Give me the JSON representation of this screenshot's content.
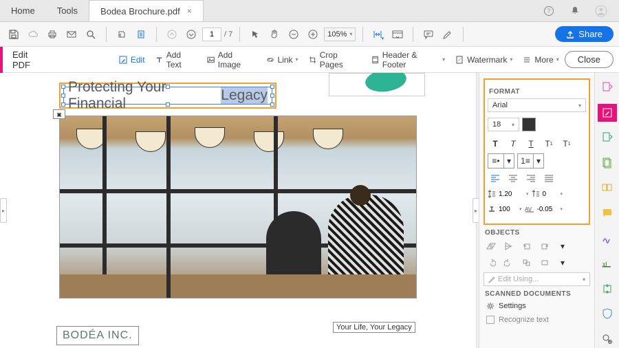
{
  "tabs": {
    "home": "Home",
    "tools": "Tools",
    "doc": "Bodea Brochure.pdf"
  },
  "toolbar": {
    "page_current": "1",
    "page_total": "/ 7",
    "zoom": "105%",
    "share": "Share"
  },
  "subtool": {
    "title": "Edit PDF",
    "edit": "Edit",
    "add_text": "Add Text",
    "add_image": "Add Image",
    "link": "Link",
    "crop": "Crop Pages",
    "header": "Header & Footer",
    "watermark": "Watermark",
    "more": "More",
    "close": "Close"
  },
  "doc": {
    "heading_pre": "Protecting Your Financial ",
    "heading_sel": "Legacy",
    "tagline": "Your Life, Your Legacy",
    "logo": "BODÉA INC."
  },
  "format": {
    "title": "FORMAT",
    "font": "Arial",
    "size": "18",
    "line_height": "1.20",
    "para_space": "0",
    "hscale": "100",
    "kerning": "-0.05"
  },
  "objects": {
    "title": "OBJECTS",
    "edit_using": "Edit Using..."
  },
  "scanned": {
    "title": "SCANNED DOCUMENTS",
    "settings": "Settings",
    "recognize": "Recognize text"
  }
}
